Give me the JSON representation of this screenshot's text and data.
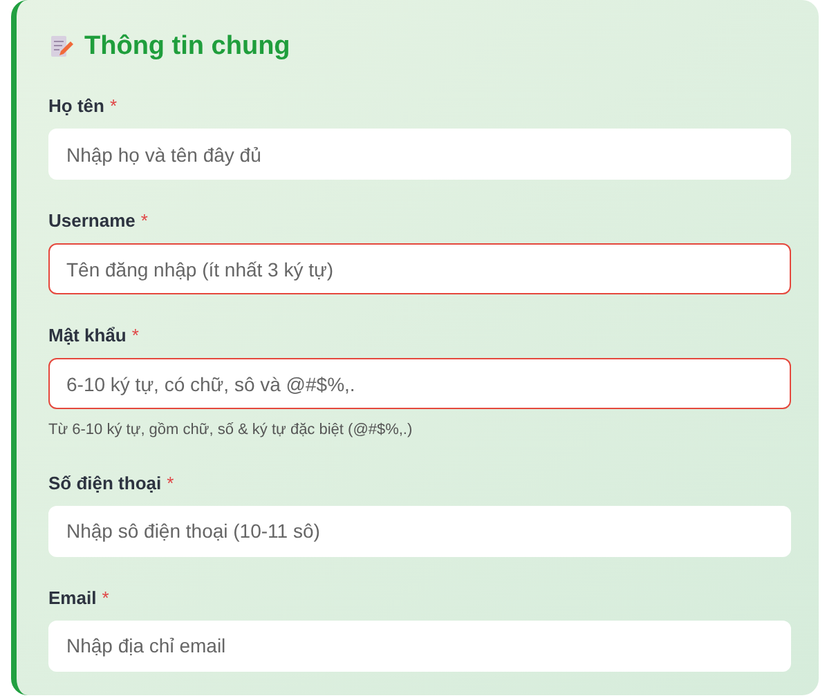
{
  "section": {
    "title": "Thông tin chung"
  },
  "fields": [
    {
      "label": "Họ tên",
      "required_mark": "*",
      "placeholder": "Nhập họ và tên đây đủ",
      "error": false
    },
    {
      "label": "Username",
      "required_mark": "*",
      "placeholder": "Tên đăng nhập (ít nhất 3 ký tự)",
      "error": true
    },
    {
      "label": "Mật khẩu",
      "required_mark": "*",
      "placeholder": "6-10 ký tự, có chữ, sô và @#$%,.",
      "error": true,
      "hint": "Từ 6-10 ký tự, gồm chữ, số & ký tự đặc biệt (@#$%,.)"
    },
    {
      "label": "Số điện thoại",
      "required_mark": "*",
      "placeholder": "Nhập sô điện thoại (10-11 sô)",
      "error": false
    },
    {
      "label": "Email",
      "required_mark": "*",
      "placeholder": "Nhập địa chỉ email",
      "error": false
    }
  ]
}
